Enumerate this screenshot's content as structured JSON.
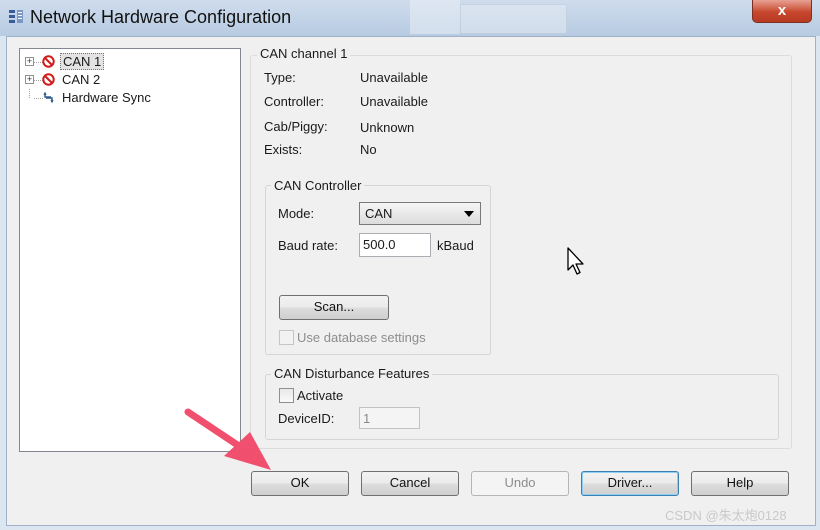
{
  "window": {
    "title": "Network Hardware Configuration",
    "close_label": "x"
  },
  "tree": {
    "items": [
      {
        "label": "CAN 1",
        "expander": "+",
        "icon": "no-entry-icon",
        "selected": true
      },
      {
        "label": "CAN 2",
        "expander": "+",
        "icon": "no-entry-icon",
        "selected": false
      },
      {
        "label": "Hardware Sync",
        "expander": "",
        "icon": "sync-icon",
        "selected": false
      }
    ]
  },
  "channel": {
    "title": "CAN channel 1",
    "fields": [
      {
        "label": "Type:",
        "value": "Unavailable"
      },
      {
        "label": "Controller:",
        "value": "Unavailable"
      },
      {
        "label": "Cab/Piggy:",
        "value": "Unknown"
      },
      {
        "label": "Exists:",
        "value": "No"
      }
    ]
  },
  "controller": {
    "title": "CAN Controller",
    "mode_label": "Mode:",
    "mode_value": "CAN",
    "baud_label": "Baud rate:",
    "baud_value": "500.0",
    "baud_unit": "kBaud",
    "scan_label": "Scan...",
    "use_db_label": "Use database settings"
  },
  "disturbance": {
    "title": "CAN Disturbance Features",
    "activate_label": "Activate",
    "device_id_label": "DeviceID:",
    "device_id_value": "1"
  },
  "buttons": {
    "ok": "OK",
    "cancel": "Cancel",
    "undo": "Undo",
    "driver": "Driver...",
    "help": "Help"
  },
  "watermark": "CSDN @朱太炮0128",
  "colors": {
    "accent_border": "#3c7fb1",
    "close_red": "#c7472e",
    "annotation_arrow": "#f0506e"
  }
}
